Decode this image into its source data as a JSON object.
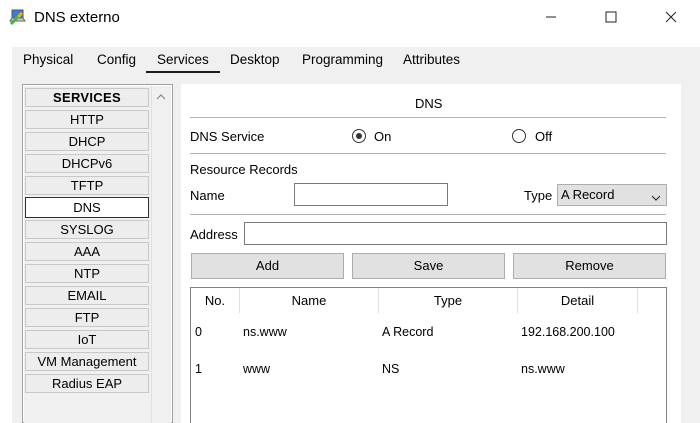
{
  "window": {
    "title": "DNS externo",
    "icon": "cisco-laptop-icon"
  },
  "tabs": [
    {
      "label": "Physical"
    },
    {
      "label": "Config"
    },
    {
      "label": "Services",
      "active": true
    },
    {
      "label": "Desktop"
    },
    {
      "label": "Programming"
    },
    {
      "label": "Attributes"
    }
  ],
  "sidebar": {
    "header": "SERVICES",
    "items": [
      {
        "label": "HTTP"
      },
      {
        "label": "DHCP"
      },
      {
        "label": "DHCPv6"
      },
      {
        "label": "TFTP"
      },
      {
        "label": "DNS",
        "active": true
      },
      {
        "label": "SYSLOG"
      },
      {
        "label": "AAA"
      },
      {
        "label": "NTP"
      },
      {
        "label": "EMAIL"
      },
      {
        "label": "FTP"
      },
      {
        "label": "IoT"
      },
      {
        "label": "VM Management"
      },
      {
        "label": "Radius EAP"
      }
    ]
  },
  "dns": {
    "title": "DNS",
    "service_label": "DNS Service",
    "on_label": "On",
    "off_label": "Off",
    "service_state": "On",
    "resource_records_label": "Resource Records",
    "name_label": "Name",
    "name_value": "",
    "type_label": "Type",
    "type_value": "A Record",
    "address_label": "Address",
    "address_value": "",
    "buttons": {
      "add": "Add",
      "save": "Save",
      "remove": "Remove"
    },
    "table": {
      "headers": [
        "No.",
        "Name",
        "Type",
        "Detail"
      ],
      "rows": [
        [
          "0",
          "ns.www",
          "A Record",
          "192.168.200.100"
        ],
        [
          "1",
          "www",
          "NS",
          "ns.www"
        ]
      ]
    }
  }
}
